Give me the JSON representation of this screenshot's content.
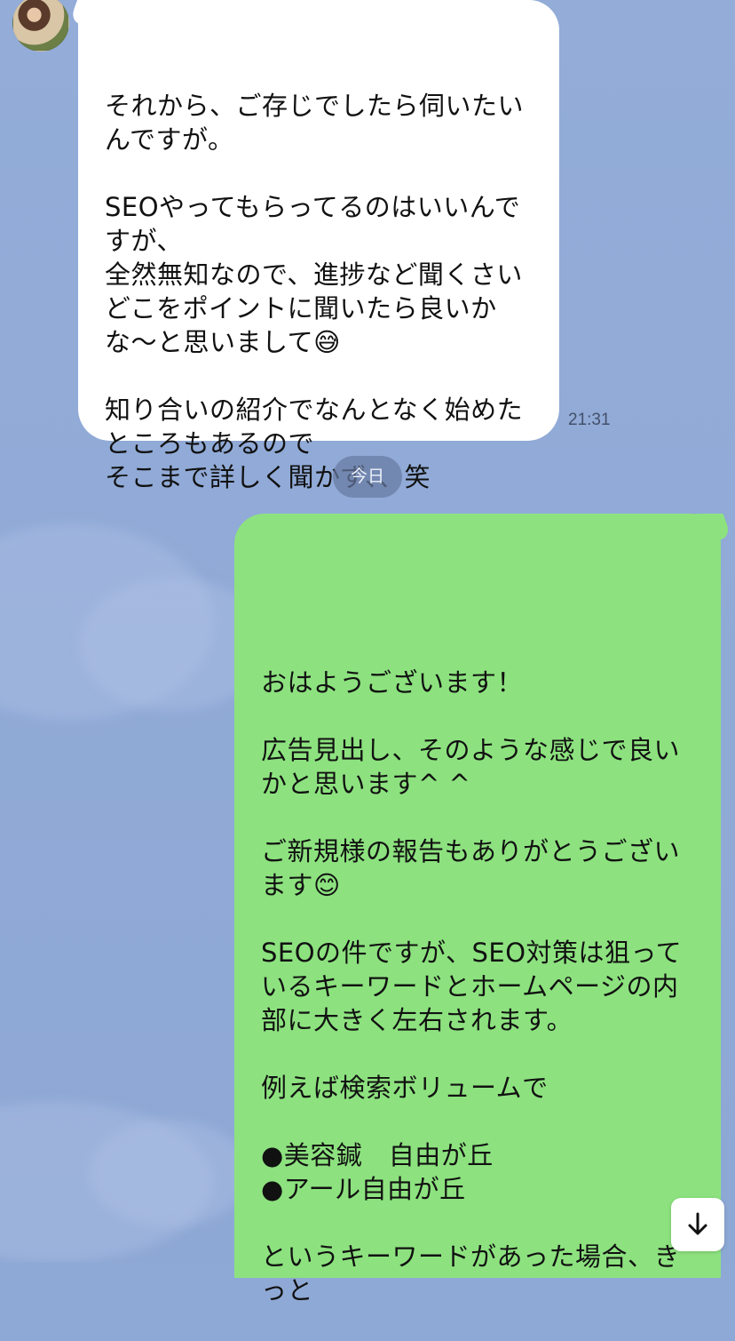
{
  "chat": {
    "incoming_message": {
      "text": "それから、ご存じでしたら伺いたいんですが。\n\nSEOやってもらってるのはいいんですが、\n全然無知なので、進捗など聞くさいどこをポイントに聞いたら良いかな〜と思いまして😅\n\n知り合いの紹介でなんとなく始めたところもあるので\nそこまで詳しく聞かず、、笑",
      "time": "21:31"
    },
    "date_label": "今日",
    "outgoing_message": {
      "text": "おはようございます！\n\n広告見出し、そのような感じで良いかと思います^ ^\n\nご新規様の報告もありがとうございます😊\n\nSEOの件ですが、SEO対策は狙っているキーワードとホームページの内部に大きく左右されます。\n\n例えば検索ボリュームで\n\n●美容鍼　自由が丘\n●アール自由が丘\n\nというキーワードがあった場合、きっと"
    }
  },
  "icons": {
    "avatar": "user-avatar",
    "scroll_down": "arrow-down-icon"
  },
  "colors": {
    "chat_background": "#8fa9d6",
    "incoming_bubble": "#ffffff",
    "outgoing_bubble": "#8de27f",
    "date_pill": "#6b7ca2"
  }
}
